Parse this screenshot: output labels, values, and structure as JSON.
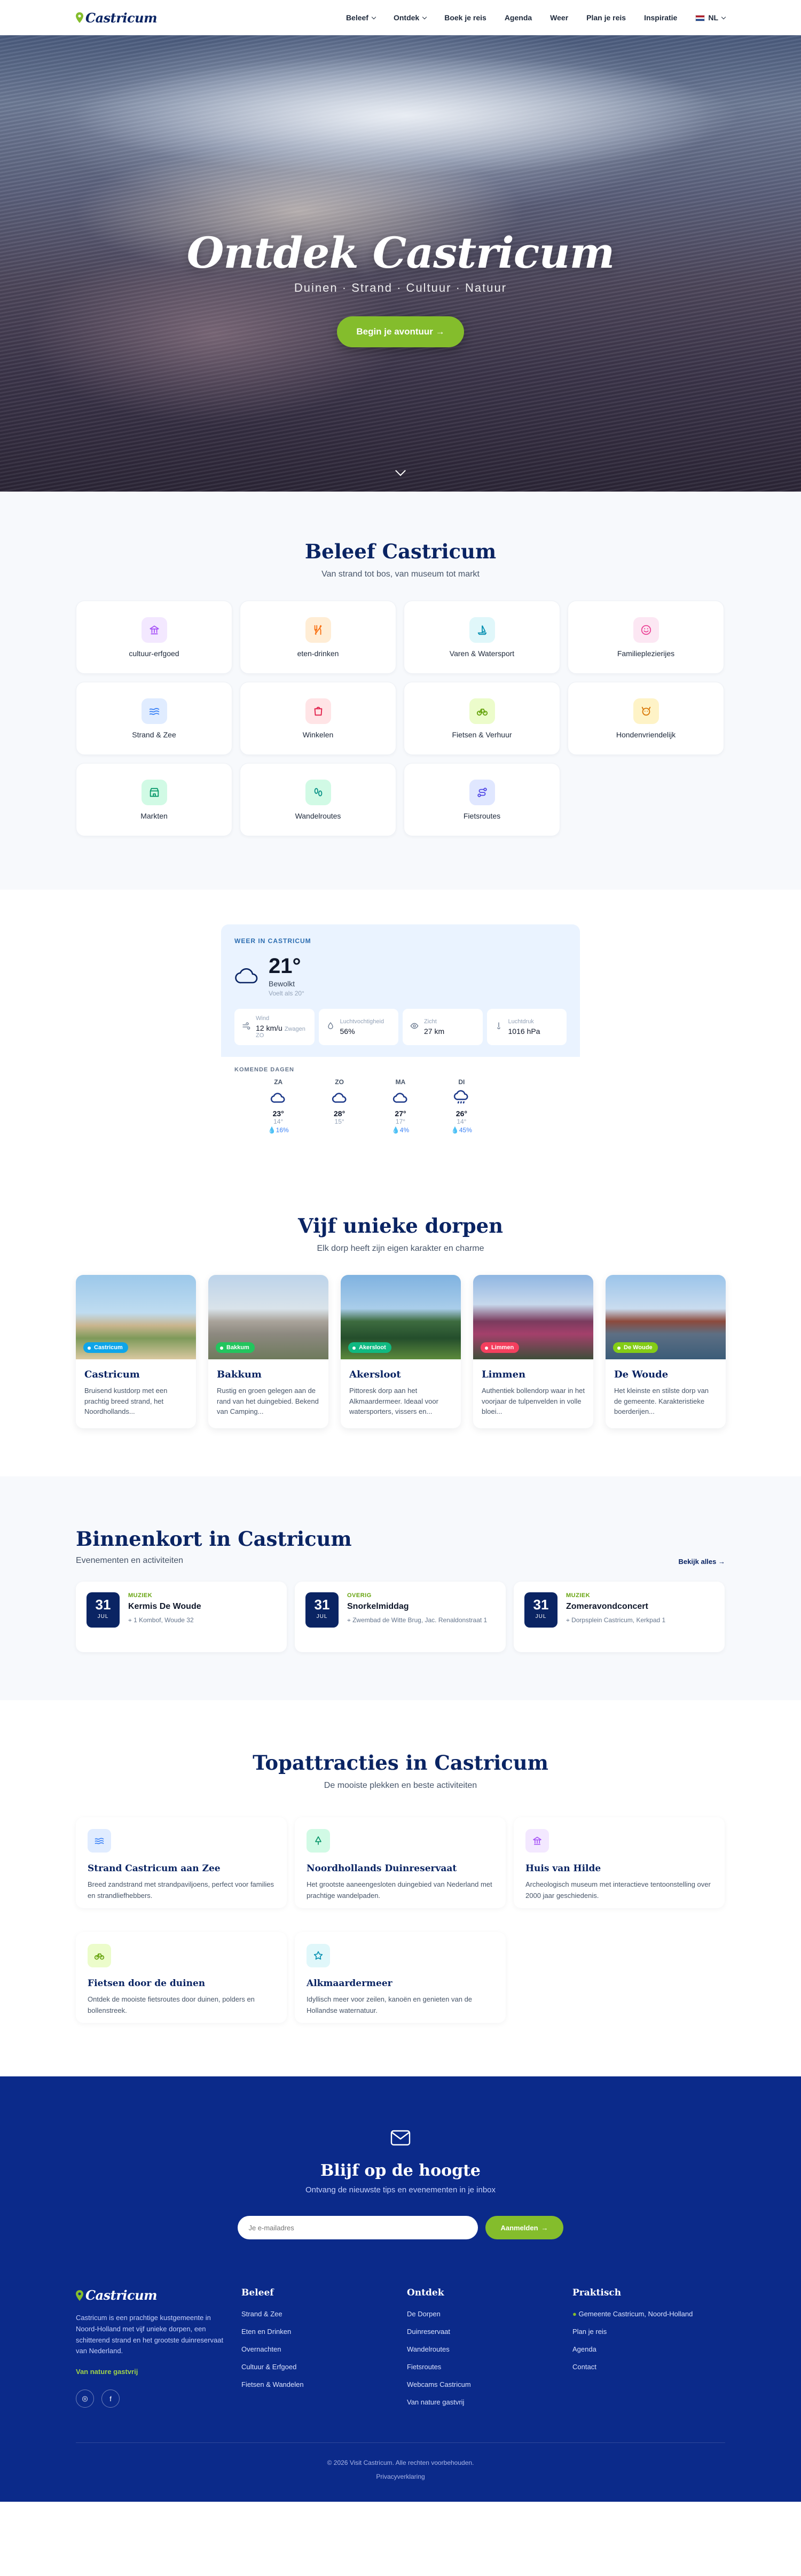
{
  "nav": {
    "logo": "Castricum",
    "items": [
      {
        "label": "Beleef",
        "dropdown": true
      },
      {
        "label": "Ontdek",
        "dropdown": true
      },
      {
        "label": "Boek je reis",
        "dropdown": false
      },
      {
        "label": "Agenda",
        "dropdown": false
      },
      {
        "label": "Weer",
        "dropdown": false
      },
      {
        "label": "Plan je reis",
        "dropdown": false
      },
      {
        "label": "Inspiratie",
        "dropdown": false
      }
    ],
    "language": "NL"
  },
  "hero": {
    "title": "Ontdek Castricum",
    "subtitle": "Duinen · Strand · Cultuur · Natuur",
    "cta": "Begin je avontuur →"
  },
  "beleef": {
    "title": "Beleef Castricum",
    "subtitle": "Van strand tot bos, van museum tot markt",
    "categories": [
      {
        "label": "cultuur-erfgoed",
        "icon": "museum-icon",
        "bg": "#f3e8ff",
        "color": "#a855f7"
      },
      {
        "label": "eten-drinken",
        "icon": "utensils-icon",
        "bg": "#ffedd5",
        "color": "#f97316"
      },
      {
        "label": "Varen & Watersport",
        "icon": "sailboat-icon",
        "bg": "#e0f7fa",
        "color": "#0891b2"
      },
      {
        "label": "Familieplezierijes",
        "icon": "smile-icon",
        "bg": "#fce7f3",
        "color": "#ec4899"
      },
      {
        "label": "Strand & Zee",
        "icon": "waves-icon",
        "bg": "#e0ecff",
        "color": "#3b82f6"
      },
      {
        "label": "Winkelen",
        "icon": "shopping-bag-icon",
        "bg": "#ffe4e6",
        "color": "#e11d48"
      },
      {
        "label": "Fietsen & Verhuur",
        "icon": "bike-icon",
        "bg": "#ecfccb",
        "color": "#65a30d"
      },
      {
        "label": "Hondenvriendelijk",
        "icon": "dog-icon",
        "bg": "#fef3c7",
        "color": "#d97706"
      },
      {
        "label": "Markten",
        "icon": "store-icon",
        "bg": "#d1fae5",
        "color": "#059669"
      },
      {
        "label": "Wandelroutes",
        "icon": "footprints-icon",
        "bg": "#d1fae5",
        "color": "#0d9488"
      },
      {
        "label": "Fietsroutes",
        "icon": "route-icon",
        "bg": "#e0e7ff",
        "color": "#4f46e5"
      }
    ]
  },
  "weather": {
    "label": "WEER IN CASTRICUM",
    "temp": "21°",
    "description": "Bewolkt",
    "feels": "Voelt als 20°",
    "stats": [
      {
        "label": "Wind",
        "value": "12 km/u",
        "extra": "Zwagen",
        "extra2": "ZO",
        "icon": "wind-icon"
      },
      {
        "label": "Luchtvochtigheid",
        "value": "56%",
        "icon": "droplet-icon"
      },
      {
        "label": "Zicht",
        "value": "27 km",
        "icon": "eye-icon"
      },
      {
        "label": "Luchtdruk",
        "value": "1016 hPa",
        "icon": "thermometer-icon"
      }
    ],
    "forecast_label": "KOMENDE DAGEN",
    "forecast": [
      {
        "day": "ZA",
        "max": "23°",
        "min": "14°",
        "rain": "💧16%",
        "icon": "cloud-icon"
      },
      {
        "day": "ZO",
        "max": "28°",
        "min": "15°",
        "rain": "",
        "icon": "cloud-icon"
      },
      {
        "day": "MA",
        "max": "27°",
        "min": "17°",
        "rain": "💧4%",
        "icon": "cloud-icon"
      },
      {
        "day": "DI",
        "max": "26°",
        "min": "14°",
        "rain": "💧45%",
        "icon": "cloud-rain-icon"
      }
    ]
  },
  "dorpen": {
    "title": "Vijf unieke dorpen",
    "subtitle": "Elk dorp heeft zijn eigen karakter en charme",
    "villages": [
      {
        "name": "Castricum",
        "badge": "Castricum",
        "badge_color": "#0ea5e9",
        "desc": "Bruisend kustdorp met een prachtig breed strand, het Noordhollands..."
      },
      {
        "name": "Bakkum",
        "badge": "Bakkum",
        "badge_color": "#22c55e",
        "desc": "Rustig en groen gelegen aan de rand van het duingebied. Bekend van Camping..."
      },
      {
        "name": "Akersloot",
        "badge": "Akersloot",
        "badge_color": "#10b981",
        "desc": "Pittoresk dorp aan het Alkmaardermeer. Ideaal voor watersporters, vissers en..."
      },
      {
        "name": "Limmen",
        "badge": "Limmen",
        "badge_color": "#f43f5e",
        "desc": "Authentiek bollendorp waar in het voorjaar de tulpenvelden in volle bloei..."
      },
      {
        "name": "De Woude",
        "badge": "De Woude",
        "badge_color": "#84cc16",
        "desc": "Het kleinste en stilste dorp van de gemeente. Karakteristieke boerderijen..."
      }
    ]
  },
  "events": {
    "title": "Binnenkort in Castricum",
    "subtitle": "Evenementen en activiteiten",
    "view_all": "Bekijk alles →",
    "items": [
      {
        "day": "31",
        "month": "JUL",
        "category": "MUZIEK",
        "title": "Kermis De Woude",
        "location": "1 Kombof, Woude 32"
      },
      {
        "day": "31",
        "month": "JUL",
        "category": "OVERIG",
        "title": "Snorkelmiddag",
        "location": "Zwembad de Witte Brug, Jac. Renaldonstraat 1"
      },
      {
        "day": "31",
        "month": "JUL",
        "category": "MUZIEK",
        "title": "Zomeravondconcert",
        "location": "Dorpsplein Castricum, Kerkpad 1"
      }
    ]
  },
  "attractions": {
    "title": "Topattracties in Castricum",
    "subtitle": "De mooiste plekken en beste activiteiten",
    "items": [
      {
        "name": "Strand Castricum aan Zee",
        "desc": "Breed zandstrand met strandpaviljoens, perfect voor families en strandliefhebbers.",
        "icon": "waves-icon",
        "bg": "#e0ecff",
        "color": "#3b82f6"
      },
      {
        "name": "Noordhollands Duinreservaat",
        "desc": "Het grootste aaneengesloten duingebied van Nederland met prachtige wandelpaden.",
        "icon": "tree-icon",
        "bg": "#d1fae5",
        "color": "#059669"
      },
      {
        "name": "Huis van Hilde",
        "desc": "Archeologisch museum met interactieve tentoonstelling over 2000 jaar geschiedenis.",
        "icon": "museum-icon",
        "bg": "#f3e8ff",
        "color": "#a855f7"
      },
      {
        "name": "Fietsen door de duinen",
        "desc": "Ontdek de mooiste fietsroutes door duinen, polders en bollenstreek.",
        "icon": "bike-icon",
        "bg": "#ecfccb",
        "color": "#65a30d"
      },
      {
        "name": "Alkmaardermeer",
        "desc": "Idyllisch meer voor zeilen, kanoën en genieten van de Hollandse waternatuur.",
        "icon": "star-icon",
        "bg": "#e0f7fa",
        "color": "#0891b2"
      }
    ]
  },
  "newsletter": {
    "title": "Blijf op de hoogte",
    "subtitle": "Ontvang de nieuwste tips en evenementen in je inbox",
    "placeholder": "Je e-mailadres",
    "button": "Aanmelden"
  },
  "footer": {
    "logo": "Castricum",
    "description": "Castricum is een prachtige kustgemeente in Noord-Holland met vijf unieke dorpen, een schitterend strand en het grootste duinreservaat van Nederland.",
    "tagline": "Van nature gastvrij",
    "social": [
      "◎",
      "f"
    ],
    "columns": [
      {
        "title": "Beleef",
        "links": [
          "Strand & Zee",
          "Eten en Drinken",
          "Overnachten",
          "Cultuur & Erfgoed",
          "Fietsen & Wandelen"
        ]
      },
      {
        "title": "Ontdek",
        "links": [
          "De Dorpen",
          "Duinreservaat",
          "Wandelroutes",
          "Fietsroutes",
          "Webcams Castricum",
          "Van nature gastvrij"
        ]
      },
      {
        "title": "Praktisch",
        "links": [
          "Gemeente Castricum, Noord-Holland",
          "Plan je reis",
          "Agenda",
          "Contact"
        ]
      }
    ],
    "copyright": "© 2026 Visit Castricum. Alle rechten voorbehouden.",
    "privacy": "Privacyverklaring"
  }
}
